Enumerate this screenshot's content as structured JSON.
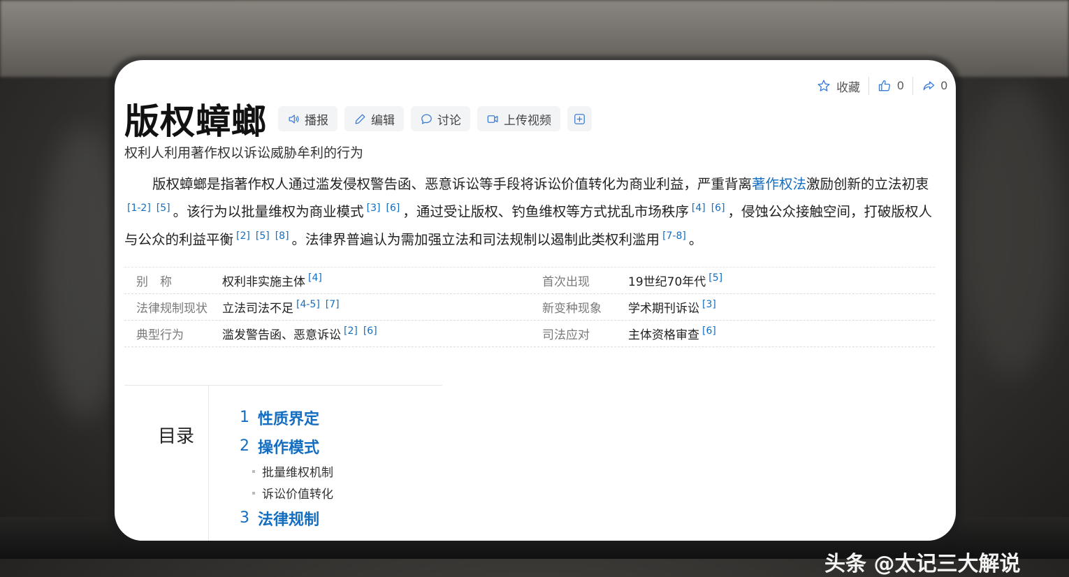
{
  "actions": {
    "favorite_label": "收藏",
    "like_count": "0",
    "share_count": "0"
  },
  "title": "版权蟑螂",
  "toolbar": {
    "broadcast_label": "播报",
    "edit_label": "编辑",
    "discuss_label": "讨论",
    "upload_video_label": "上传视频"
  },
  "subtitle": "权利人利用著作权以诉讼威胁牟利的行为",
  "summary": {
    "p1": "版权蟑螂是指著作权人通过滥发侵权警告函、恶意诉讼等手段将诉讼价值转化为商业利益，严重背离",
    "link": "著作权法",
    "p2": "激励创新的立法初衷",
    "r1": "[1-2]",
    "r2": "[5]",
    "p3": "。该行为以批量维权为商业模式",
    "r3": "[3]",
    "r4": "[6]",
    "p4": "，通过受让版权、钓鱼维权等方式扰乱市场秩序",
    "r5": "[4]",
    "r6": "[6]",
    "p5": "，侵蚀公众接触空间，打破版权人与公众的利益平衡",
    "r7": "[2]",
    "r8": "[5]",
    "r9": "[8]",
    "p6": "。法律界普遍认为需加强立法和司法规制以遏制此类权利滥用",
    "r10": "[7-8]",
    "p7": "。"
  },
  "info": [
    {
      "l1": "别　称",
      "v1": "权利非实施主体",
      "v1r": [
        "[4]"
      ],
      "l2": "首次出现",
      "v2": "19世纪70年代",
      "v2r": [
        "[5]"
      ]
    },
    {
      "l1": "法律规制现状",
      "v1": "立法司法不足",
      "v1r": [
        "[4-5]",
        "[7]"
      ],
      "l2": "新变种现象",
      "v2": "学术期刊诉讼",
      "v2r": [
        "[3]"
      ]
    },
    {
      "l1": "典型行为",
      "v1": "滥发警告函、恶意诉讼",
      "v1r": [
        "[2]",
        "[6]"
      ],
      "l2": "司法应对",
      "v2": "主体资格审查",
      "v2r": [
        "[6]"
      ]
    }
  ],
  "toc": {
    "heading": "目录",
    "items": [
      {
        "num": "1",
        "label": "性质界定"
      },
      {
        "num": "2",
        "label": "操作模式"
      },
      {
        "sub": "批量维权机制"
      },
      {
        "sub": "诉讼价值转化"
      },
      {
        "num": "3",
        "label": "法律规制"
      }
    ]
  },
  "watermark": "头条 @太记三大解说"
}
